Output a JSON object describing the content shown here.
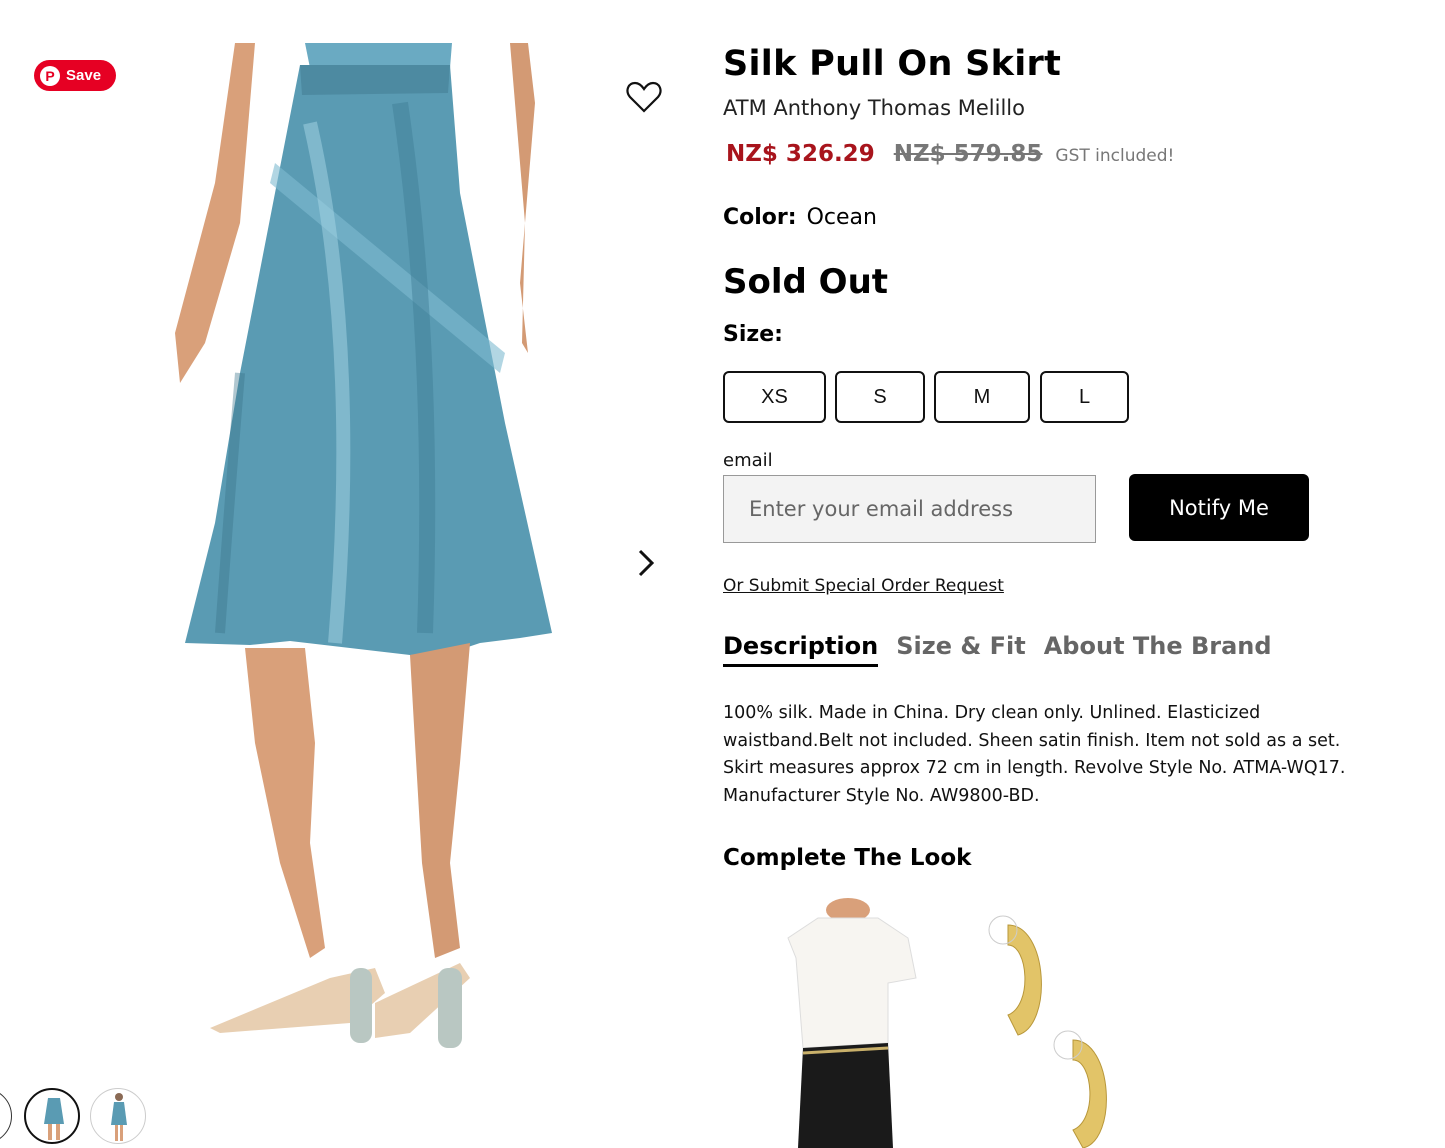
{
  "gallery": {
    "save_label": "Save",
    "pin_glyph": "P"
  },
  "product": {
    "title": "Silk Pull On Skirt",
    "brand": "ATM Anthony Thomas Melillo",
    "price_sale": "NZ$ 326.29",
    "price_original": "NZ$ 579.85",
    "gst_note": "GST included!",
    "color_label": "Color:",
    "color_value": "Ocean",
    "availability": "Sold Out",
    "size_label": "Size:",
    "sizes": [
      "XS",
      "S",
      "M",
      "L"
    ]
  },
  "notify": {
    "email_label": "email",
    "email_placeholder": "Enter your email address",
    "button_label": "Notify Me",
    "special_order_link": "Or Submit Special Order Request"
  },
  "tabs": {
    "description": "Description",
    "size_fit": "Size & Fit",
    "about_brand": "About The Brand"
  },
  "description_text": "100% silk. Made in China. Dry clean only. Unlined. Elasticized waistband.Belt not included. Sheen satin finish. Item not sold as a set. Skirt measures approx 72 cm in length. Revolve Style No. ATMA-WQ17. Manufacturer Style No. AW9800-BD.",
  "complete_look": {
    "heading": "Complete The Look"
  },
  "colors": {
    "sale_price": "#a8141c",
    "pinterest": "#e60023",
    "skirt": "#5a9bb3",
    "button_bg": "#000000"
  }
}
